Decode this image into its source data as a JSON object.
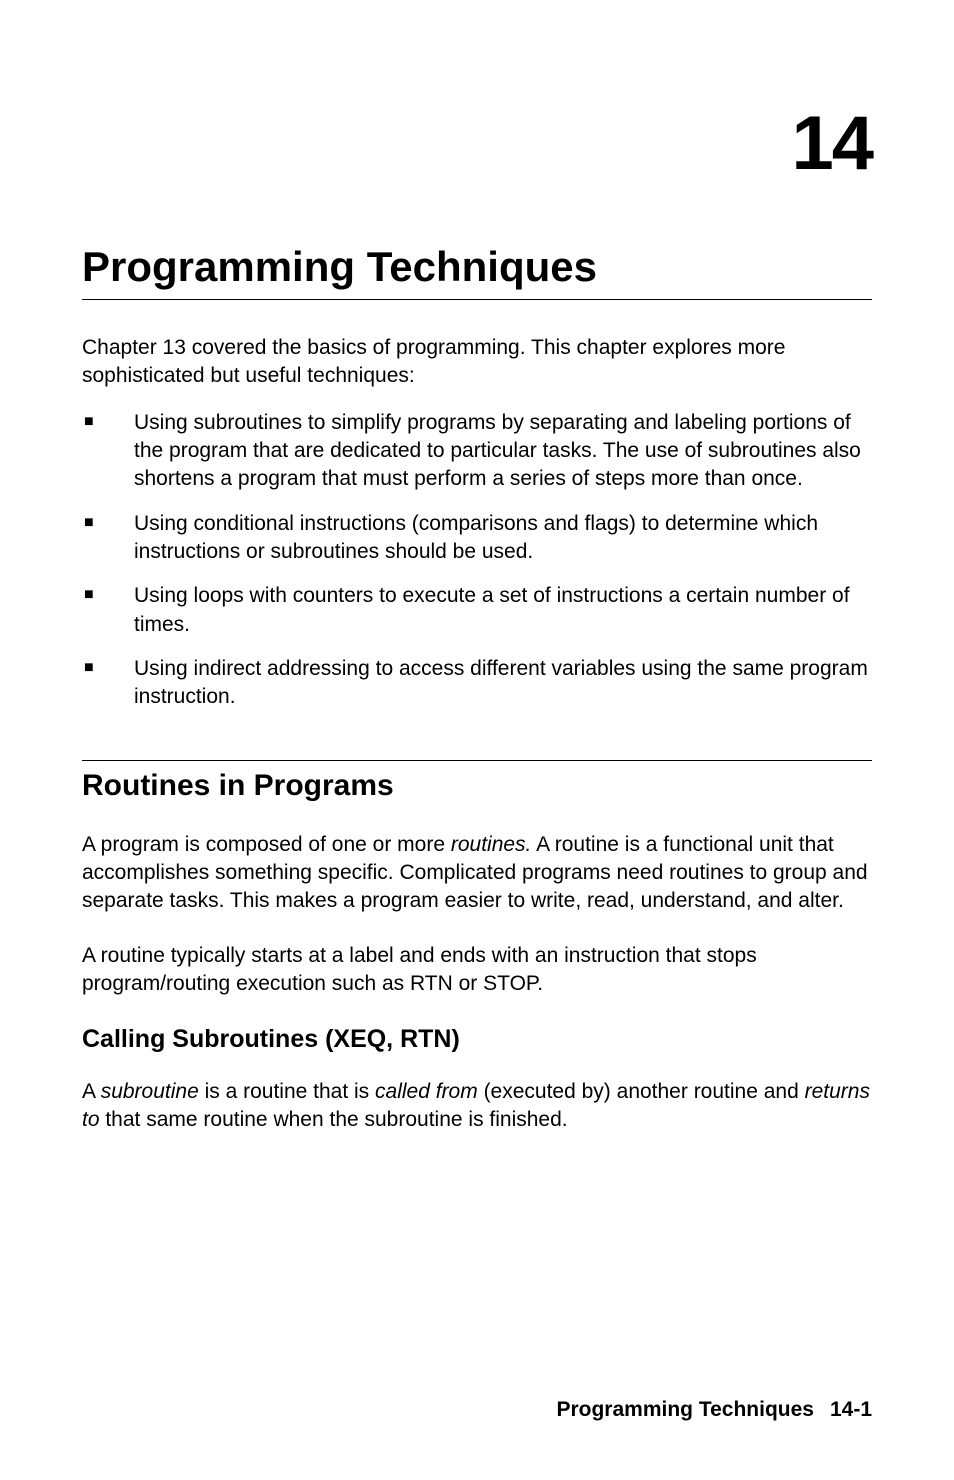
{
  "chapter": {
    "number": "14",
    "title": "Programming Techniques"
  },
  "intro": "Chapter 13 covered the basics of programming. This chapter explores more sophisticated but useful techniques:",
  "bullets": [
    "Using subroutines to simplify programs by separating and labeling portions of the program that are dedicated to particular tasks. The use of subroutines also shortens a program that must perform a series of steps more than once.",
    "Using conditional instructions (comparisons and flags) to determine which instructions or subroutines should be used.",
    "Using loops with counters to execute a set of instructions a certain number of times.",
    "Using indirect addressing to access different variables using the same program instruction."
  ],
  "section": {
    "title": "Routines in Programs",
    "para1_pre": "A program is composed of one or more ",
    "para1_italic": "routines.",
    "para1_post": " A routine is a functional unit that accomplishes something specific. Complicated programs need routines to group and separate tasks. This makes a program easier to write, read, understand, and alter.",
    "para2": "A routine typically starts at a label and ends with an instruction that stops program/routing execution such as RTN or STOP."
  },
  "subsection": {
    "title": "Calling Subroutines (XEQ, RTN)",
    "para_parts": {
      "p1": "A ",
      "i1": "subroutine",
      "p2": " is a routine that is ",
      "i2": "called from",
      "p3": " (executed by) another routine and ",
      "i3": "returns to",
      "p4": " that same routine when the subroutine is finished."
    }
  },
  "footer": {
    "label": "Programming Techniques",
    "page": "14-1"
  }
}
